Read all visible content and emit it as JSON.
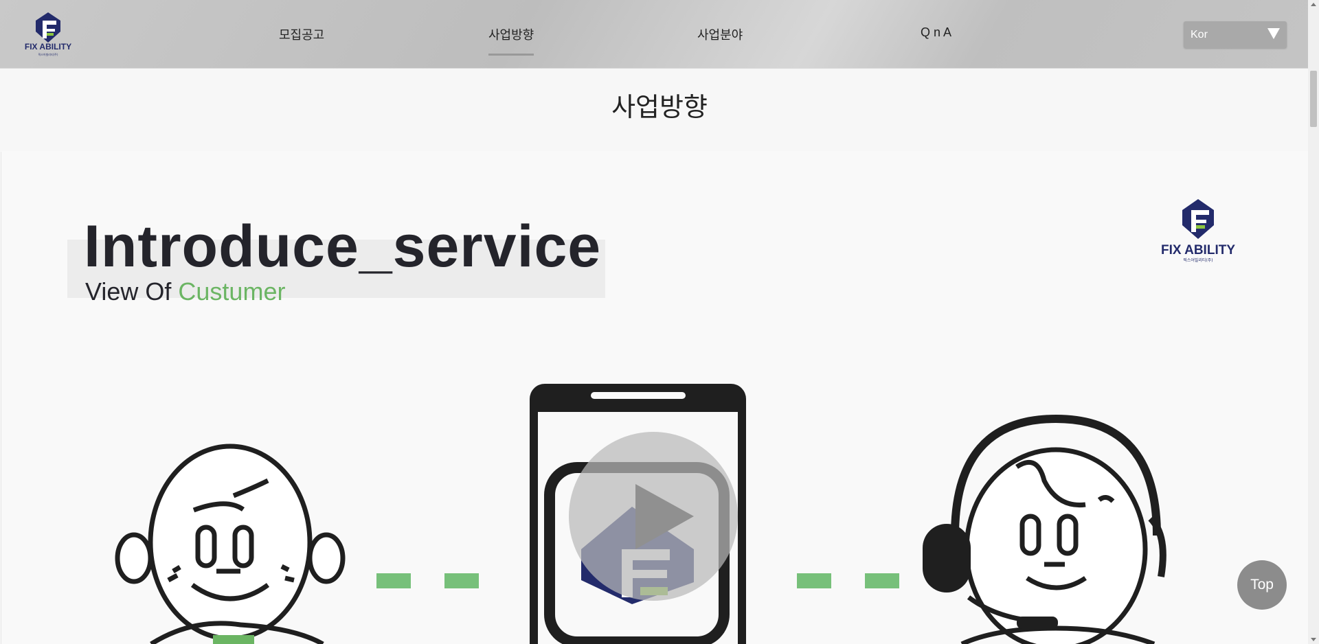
{
  "header": {
    "logo_text": "FIX ABILITY",
    "logo_subtext": "픽스어빌리티(주)",
    "nav": [
      {
        "label": "모집공고"
      },
      {
        "label": "사업방향"
      },
      {
        "label": "사업분야"
      },
      {
        "label": "Q n A"
      }
    ],
    "language": {
      "selected": "Kor"
    }
  },
  "page": {
    "title": "사업방향"
  },
  "content": {
    "headline": "Introduce_service",
    "subline_prefix": "View Of",
    "subline_highlight": "Custumer",
    "brand_logo_text": "FIX ABILITY",
    "brand_logo_subtext": "픽스어빌리티(주)"
  },
  "top_button": {
    "label": "Top"
  },
  "colors": {
    "accent_green": "#6bb563",
    "navy": "#232b6b",
    "dark_text": "#24242b",
    "header_gray": "#c4c4c4"
  },
  "icons": [
    "caret-down-icon",
    "play-icon",
    "customer-illustration",
    "phone-app-illustration",
    "support-agent-illustration"
  ]
}
